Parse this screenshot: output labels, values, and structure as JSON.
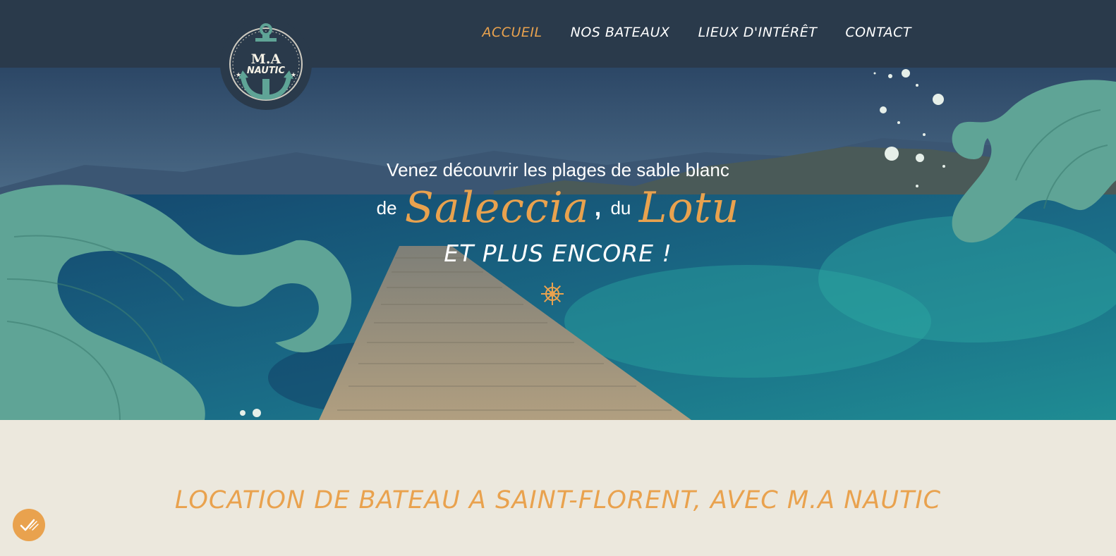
{
  "header": {
    "logo": {
      "title": "M.A",
      "subtitle": "NAUTIC"
    },
    "nav": [
      {
        "label": "ACCUEIL",
        "active": true
      },
      {
        "label": "NOS BATEAUX",
        "active": false
      },
      {
        "label": "LIEUX D'INTÉRÊT",
        "active": false
      },
      {
        "label": "CONTACT",
        "active": false
      }
    ]
  },
  "hero": {
    "line1": "Venez découvrir les plages de sable blanc",
    "line2_prefix": "de",
    "place1": "Saleccia",
    "comma": ",",
    "line2_middle": "du",
    "place2": "Lotu",
    "line3": "ET PLUS ENCORE !",
    "divider_icon": "ship-wheel-icon"
  },
  "section": {
    "title": "LOCATION DE BATEAU A SAINT-FLORENT, AVEC M.A NAUTIC"
  },
  "cookie_button": {
    "icon": "cookie-consent-icon"
  },
  "colors": {
    "navbar": "#2a3a4b",
    "accent": "#e9a24e",
    "wave": "#5fa496",
    "section_bg": "#ece8dd",
    "text_light": "#ffffff"
  }
}
